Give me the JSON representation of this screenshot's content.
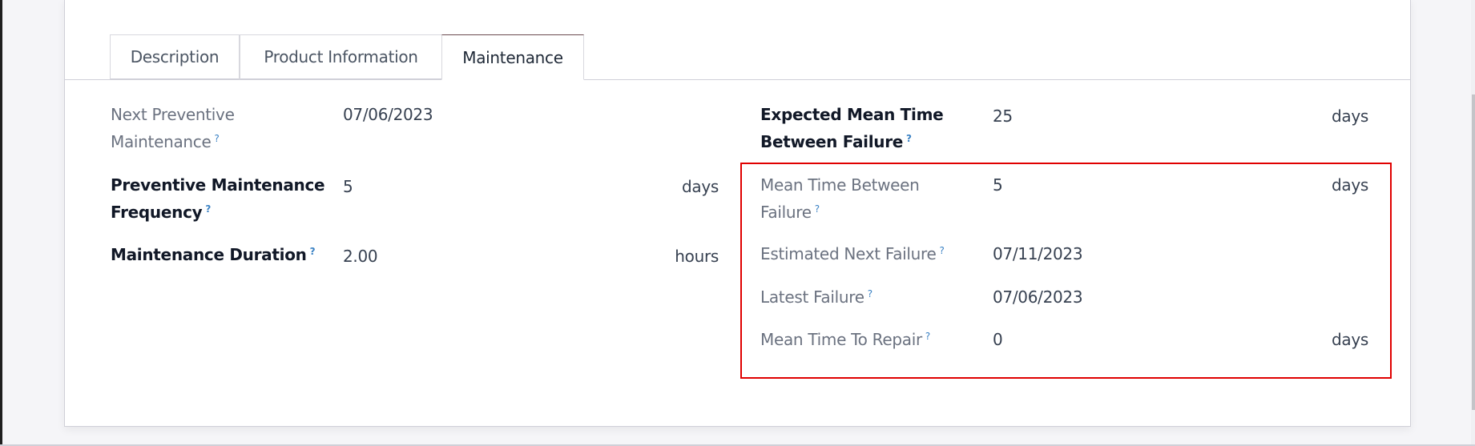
{
  "tabs": [
    {
      "label": "Description",
      "active": false
    },
    {
      "label": "Product Information",
      "active": false
    },
    {
      "label": "Maintenance",
      "active": true
    }
  ],
  "help_glyph": "?",
  "left_fields": [
    {
      "label_line1": "Next Preventive",
      "label_line2": "Maintenance",
      "value": "07/06/2023",
      "unit": ""
    },
    {
      "label_line1": "Preventive Maintenance",
      "label_line2": "Frequency",
      "value": "5",
      "unit": "days"
    },
    {
      "label": "Maintenance Duration",
      "value": "2.00",
      "unit": "hours"
    }
  ],
  "right_fields": [
    {
      "label_line1": "Expected Mean Time",
      "label_line2": "Between Failure",
      "value": "25",
      "unit": "days"
    },
    {
      "label_line1": "Mean Time Between",
      "label_line2": "Failure",
      "value": "5",
      "unit": "days"
    },
    {
      "label": "Estimated Next Failure",
      "value": "07/11/2023",
      "unit": ""
    },
    {
      "label": "Latest Failure",
      "value": "07/06/2023",
      "unit": ""
    },
    {
      "label": "Mean Time To Repair",
      "value": "0",
      "unit": "days"
    }
  ],
  "highlight_color": "#e00000"
}
